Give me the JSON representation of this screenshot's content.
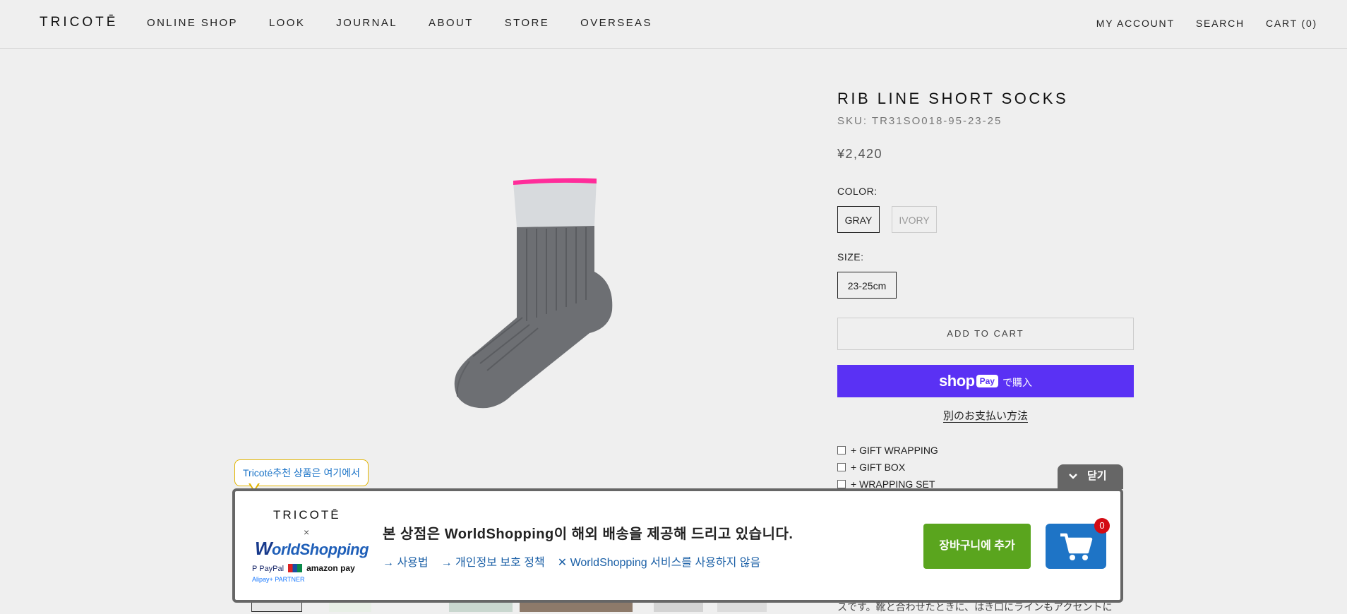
{
  "header": {
    "logo": "TRICOTĒ",
    "nav": [
      "ONLINE SHOP",
      "LOOK",
      "JOURNAL",
      "ABOUT",
      "STORE",
      "OVERSEAS"
    ],
    "account": "MY ACCOUNT",
    "search": "SEARCH",
    "cart": "CART (0)"
  },
  "product": {
    "title": "RIB LINE SHORT SOCKS",
    "sku": "SKU: TR31SO018-95-23-25",
    "price": "¥2,420",
    "color_label": "COLOR:",
    "colors": [
      "GRAY",
      "IVORY"
    ],
    "selected_color": "GRAY",
    "size_label": "SIZE:",
    "sizes": [
      "23-25cm"
    ],
    "add_to_cart": "ADD TO CART",
    "shop_pay_brand": "shop",
    "shop_pay_badge": "Pay",
    "shop_pay_suffix": "で購入",
    "alt_payment": "別のお支払い方法",
    "addons": [
      "+ GIFT WRAPPING",
      "+ GIFT BOX",
      "+ WRAPPING SET"
    ],
    "description_partial": "スです。靴と合わせたときに、はき口にラインもアクセントに"
  },
  "worldshopping": {
    "tooltip": "Tricoté추천 상품은 여기에서",
    "close_label": "닫기",
    "brand_logo": "TRICOTĒ",
    "times": "×",
    "ws_logo_w": "W",
    "ws_logo_rest": "orldShopping",
    "pay_paypal": "P PayPal",
    "pay_amazon": "amazon pay",
    "pay_alipay": "Alipay+ PARTNER",
    "headline": "본 상점은 WorldShopping이 해외 배송을 제공해 드리고 있습니다.",
    "links": [
      "→ 사용법",
      "→ 개인정보 보호 정책",
      "✕ WorldShopping 서비스를 사용하지 않음"
    ],
    "add_button": "장바구니에 추가",
    "cart_count": "0"
  },
  "colors": {
    "background": "#efefef",
    "shop_pay": "#5a31f4",
    "ws_green": "#5aa51e",
    "ws_blue": "#1e74c6",
    "badge_red": "#d30b14",
    "link_blue": "#1a5fa6"
  }
}
